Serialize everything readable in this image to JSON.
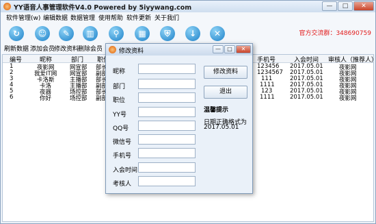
{
  "app": {
    "title": "YY语音人事管理软件V4.0 Powered by 5iyywang.com",
    "min_glyph": "—",
    "max_glyph": "□",
    "close_glyph": "✕"
  },
  "menu": [
    "软件管理(w)",
    "编辑数据",
    "数据管理",
    "使用帮助",
    "软件更新",
    "关于我们"
  ],
  "toolbar": {
    "buttons": [
      {
        "label": "刷新数据",
        "icon": "refresh-icon",
        "glyph": "↻"
      },
      {
        "label": "添加会员",
        "icon": "user-add-icon",
        "glyph": "☺"
      },
      {
        "label": "修改资料",
        "icon": "edit-icon",
        "glyph": "✎"
      },
      {
        "label": "删除会员",
        "icon": "trash-icon",
        "glyph": "▥"
      },
      {
        "label": "",
        "icon": "search-icon",
        "glyph": "⚲"
      },
      {
        "label": "",
        "icon": "grid-icon",
        "glyph": "▦"
      },
      {
        "label": "",
        "icon": "shield-icon",
        "glyph": "⛨"
      },
      {
        "label": "",
        "icon": "download-icon",
        "glyph": "↓"
      },
      {
        "label": "",
        "icon": "close-icon",
        "glyph": "✕"
      }
    ],
    "qq_group": "官方交流群：348690759"
  },
  "table": {
    "left_columns": [
      "编号",
      "昵称",
      "部门",
      "职位"
    ],
    "right_columns": [
      "手机号",
      "入会时间",
      "审核人（推荐人）"
    ],
    "rows": [
      {
        "id": "1",
        "name": "夜影网",
        "dept": "网宣部",
        "pos": "部长",
        "phone": "123456",
        "date": "2017.05.01",
        "auditor": "夜影网"
      },
      {
        "id": "2",
        "name": "我爱IT网",
        "dept": "网宣部",
        "pos": "副部",
        "phone": "1234567",
        "date": "2017.05.01",
        "auditor": "夜影网"
      },
      {
        "id": "3",
        "name": "卡洛斯",
        "dept": "主播部",
        "pos": "部长",
        "phone": "111",
        "date": "2017.05.01",
        "auditor": "夜影网"
      },
      {
        "id": "4",
        "name": "卡洛",
        "dept": "主播部",
        "pos": "副部",
        "phone": "1111",
        "date": "2017.05.01",
        "auditor": "夜影网"
      },
      {
        "id": "5",
        "name": "夜器",
        "dept": "场控部",
        "pos": "部长",
        "phone": "123",
        "date": "2017.05.01",
        "auditor": "夜影网"
      },
      {
        "id": "6",
        "name": "你好",
        "dept": "场控部",
        "pos": "副部",
        "phone": "1111",
        "date": "2017.05.01",
        "auditor": "夜影网"
      }
    ]
  },
  "dialog": {
    "title": "修改资料",
    "min_glyph": "—",
    "max_glyph": "□",
    "close_glyph": "✕",
    "fields": [
      {
        "label": "昵称",
        "value": ""
      },
      {
        "label": "部门",
        "value": ""
      },
      {
        "label": "职位",
        "value": ""
      },
      {
        "label": "YY号",
        "value": ""
      },
      {
        "label": "QQ号",
        "value": ""
      },
      {
        "label": "微信号",
        "value": ""
      },
      {
        "label": "手机号",
        "value": ""
      },
      {
        "label": "入会时间",
        "value": ""
      },
      {
        "label": "考核人",
        "value": ""
      }
    ],
    "save_label": "修改资料",
    "exit_label": "退出",
    "hint_title": "温馨提示",
    "hint_line1": "日期正确格式为",
    "hint_line2": "2017.05.01"
  },
  "colors": {
    "accent": "#1e82c9",
    "qq_text": "#e21b1b",
    "close": "#c9442a"
  }
}
